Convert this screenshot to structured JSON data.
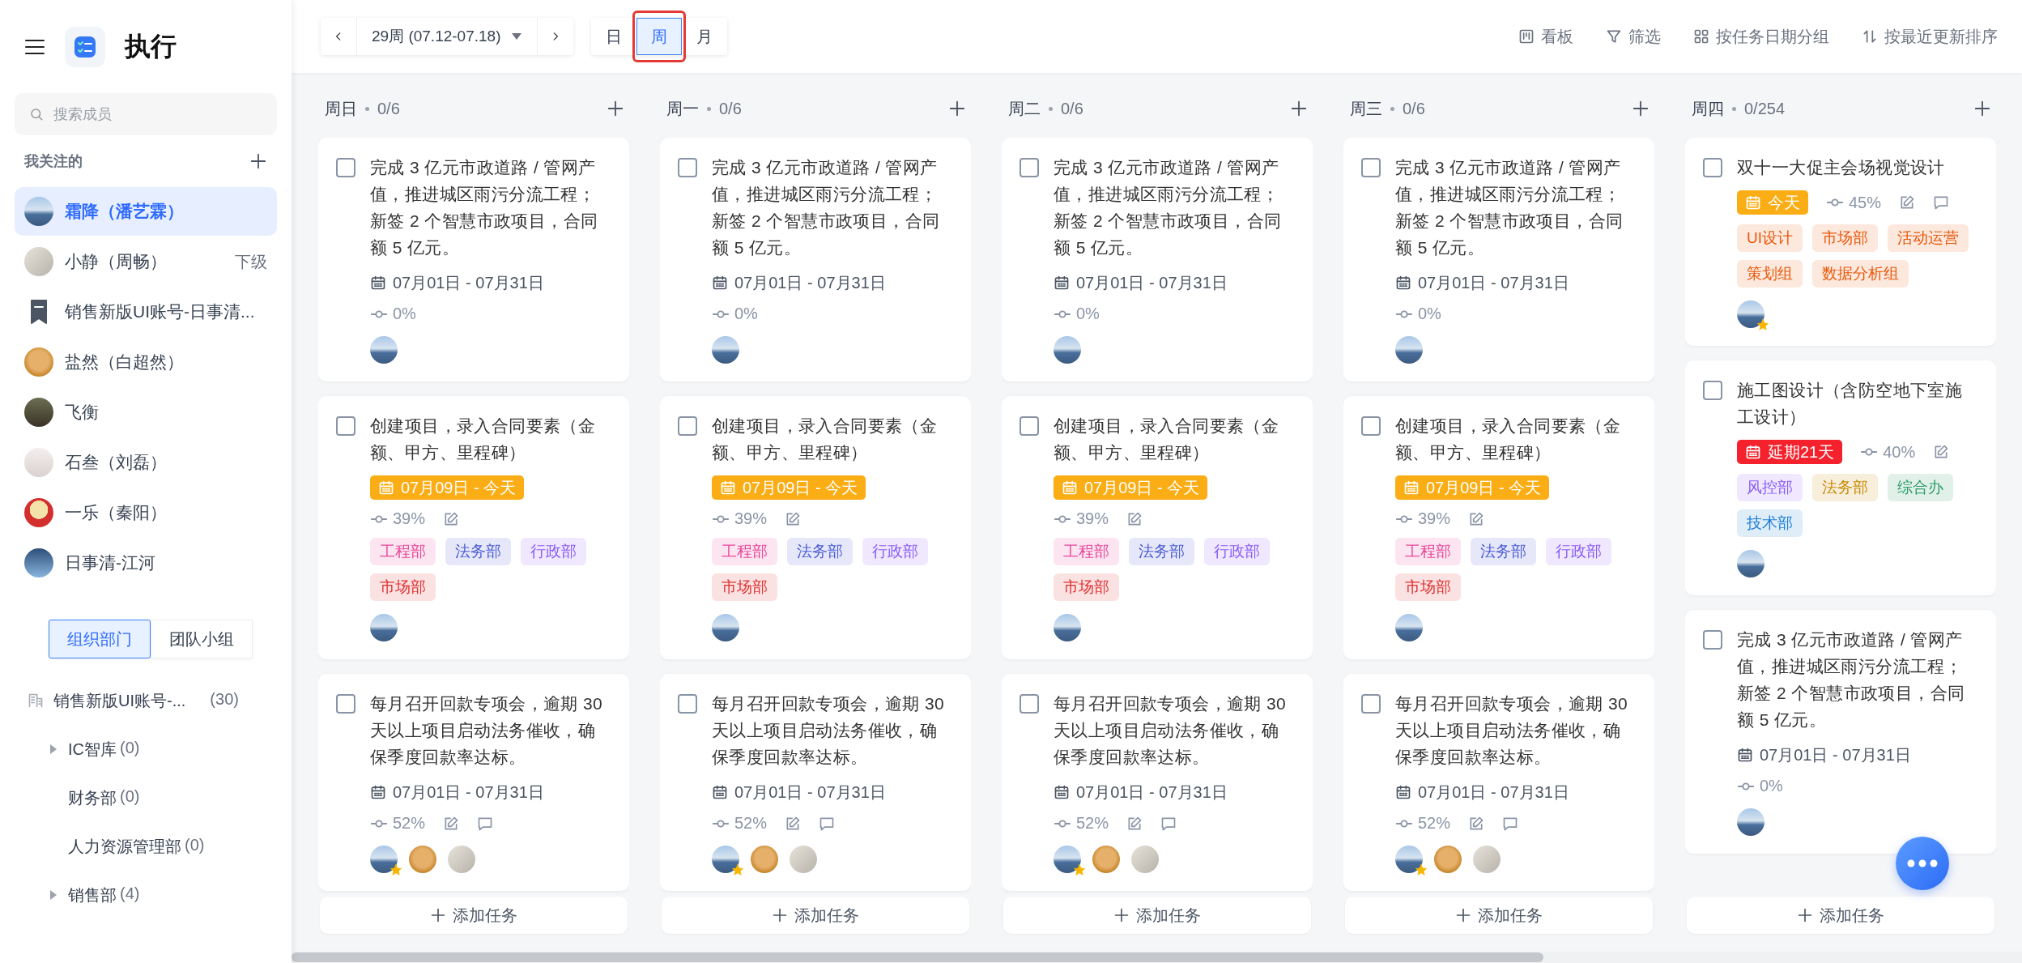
{
  "app": {
    "title": "执行"
  },
  "sidebar": {
    "search": {
      "placeholder": "搜索成员"
    },
    "followed_heading": "我关注的",
    "followed": [
      {
        "name": "霜降（潘艺霖）",
        "kind": "sea",
        "selected": true
      },
      {
        "name": "小静（周畅）",
        "kind": "sketch",
        "selected": false,
        "tag": "下级"
      },
      {
        "name": "销售新版UI账号-日事清...",
        "kind": "bookmark",
        "selected": false
      },
      {
        "name": "盐然（白超然）",
        "kind": "bear",
        "selected": false
      },
      {
        "name": "飞衡",
        "kind": "dusk",
        "selected": false
      },
      {
        "name": "石叁（刘磊）",
        "kind": "light",
        "selected": false
      },
      {
        "name": "一乐（秦阳）",
        "kind": "cartoon",
        "selected": false
      },
      {
        "name": "日事清-江河",
        "kind": "blue",
        "selected": false
      }
    ],
    "org_tabs": [
      {
        "label": "组织部门",
        "selected": true
      },
      {
        "label": "团队小组",
        "selected": false
      }
    ],
    "tree": [
      {
        "name": "销售新版UI账号-...",
        "count": "(30)",
        "kind": "company",
        "children": [
          {
            "name": "IC智库",
            "count": "(0)",
            "kind": "folder"
          },
          {
            "name": "财务部",
            "count": "(0)",
            "kind": "leaf"
          },
          {
            "name": "人力资源管理部",
            "count": "(0)",
            "kind": "leaf"
          },
          {
            "name": "销售部",
            "count": "(4)",
            "kind": "folder"
          }
        ]
      }
    ]
  },
  "toolbar": {
    "week": "29周 (07.12-07.18)",
    "view_tabs": [
      {
        "label": "日",
        "selected": false,
        "highlighted": false
      },
      {
        "label": "周",
        "selected": true,
        "highlighted": true
      },
      {
        "label": "月",
        "selected": false,
        "highlighted": false
      }
    ],
    "actions": [
      {
        "label": "看板",
        "kind": "board"
      },
      {
        "label": "筛选",
        "kind": "filter"
      },
      {
        "label": "按任务日期分组",
        "kind": "grid"
      },
      {
        "label": "按最近更新排序",
        "kind": "sort"
      }
    ]
  },
  "columns": [
    {
      "day": "周日",
      "count": "0/6",
      "add_label": "添加任务",
      "tasks": [
        {
          "title": "完成 3 亿元市政道路 / 管网产值，推进城区雨污分流工程；新签 2 个智慧市政项目，合同额 5 亿元。",
          "checked": false,
          "date": {
            "text": "07月01日 - 07月31日",
            "kind": "normal"
          },
          "progress": "0%",
          "progress_inline": false,
          "edit": false,
          "comment": false,
          "avatars": [
            {
              "kind": "sea",
              "star": false
            }
          ]
        },
        {
          "title": "创建项目，录入合同要素（金额、甲方、里程碑）",
          "checked": false,
          "date": {
            "text": "07月09日 - 今天",
            "kind": "today"
          },
          "progress": "39%",
          "progress_inline": false,
          "edit": true,
          "comment": false,
          "tags": [
            {
              "label": "工程部",
              "color": "#e8479a"
            },
            {
              "label": "法务部",
              "color": "#4c5bd4"
            },
            {
              "label": "行政部",
              "color": "#8b5cf6"
            },
            {
              "label": "市场部",
              "color": "#e03131"
            }
          ],
          "avatars": [
            {
              "kind": "sea",
              "star": false
            }
          ]
        },
        {
          "title": "每月召开回款专项会，逾期 30 天以上项目启动法务催收，确保季度回款率达标。",
          "checked": false,
          "date": {
            "text": "07月01日 - 07月31日",
            "kind": "normal"
          },
          "progress": "52%",
          "progress_inline": false,
          "edit": true,
          "comment": true,
          "avatars": [
            {
              "kind": "sea",
              "star": true
            },
            {
              "kind": "bear",
              "star": false
            },
            {
              "kind": "sketch",
              "star": false
            }
          ]
        }
      ]
    },
    {
      "day": "周一",
      "count": "0/6",
      "add_label": "添加任务",
      "tasks": [
        {
          "title": "完成 3 亿元市政道路 / 管网产值，推进城区雨污分流工程；新签 2 个智慧市政项目，合同额 5 亿元。",
          "checked": false,
          "date": {
            "text": "07月01日 - 07月31日",
            "kind": "normal"
          },
          "progress": "0%",
          "progress_inline": false,
          "edit": false,
          "comment": false,
          "avatars": [
            {
              "kind": "sea",
              "star": false
            }
          ]
        },
        {
          "title": "创建项目，录入合同要素（金额、甲方、里程碑）",
          "checked": false,
          "date": {
            "text": "07月09日 - 今天",
            "kind": "today"
          },
          "progress": "39%",
          "progress_inline": false,
          "edit": true,
          "comment": false,
          "tags": [
            {
              "label": "工程部",
              "color": "#e8479a"
            },
            {
              "label": "法务部",
              "color": "#4c5bd4"
            },
            {
              "label": "行政部",
              "color": "#8b5cf6"
            },
            {
              "label": "市场部",
              "color": "#e03131"
            }
          ],
          "avatars": [
            {
              "kind": "sea",
              "star": false
            }
          ]
        },
        {
          "title": "每月召开回款专项会，逾期 30 天以上项目启动法务催收，确保季度回款率达标。",
          "checked": false,
          "date": {
            "text": "07月01日 - 07月31日",
            "kind": "normal"
          },
          "progress": "52%",
          "progress_inline": false,
          "edit": true,
          "comment": true,
          "avatars": [
            {
              "kind": "sea",
              "star": true
            },
            {
              "kind": "bear",
              "star": false
            },
            {
              "kind": "sketch",
              "star": false
            }
          ]
        }
      ]
    },
    {
      "day": "周二",
      "count": "0/6",
      "add_label": "添加任务",
      "tasks": [
        {
          "title": "完成 3 亿元市政道路 / 管网产值，推进城区雨污分流工程；新签 2 个智慧市政项目，合同额 5 亿元。",
          "checked": false,
          "date": {
            "text": "07月01日 - 07月31日",
            "kind": "normal"
          },
          "progress": "0%",
          "progress_inline": false,
          "edit": false,
          "comment": false,
          "avatars": [
            {
              "kind": "sea",
              "star": false
            }
          ]
        },
        {
          "title": "创建项目，录入合同要素（金额、甲方、里程碑）",
          "checked": false,
          "date": {
            "text": "07月09日 - 今天",
            "kind": "today"
          },
          "progress": "39%",
          "progress_inline": false,
          "edit": true,
          "comment": false,
          "tags": [
            {
              "label": "工程部",
              "color": "#e8479a"
            },
            {
              "label": "法务部",
              "color": "#4c5bd4"
            },
            {
              "label": "行政部",
              "color": "#8b5cf6"
            },
            {
              "label": "市场部",
              "color": "#e03131"
            }
          ],
          "avatars": [
            {
              "kind": "sea",
              "star": false
            }
          ]
        },
        {
          "title": "每月召开回款专项会，逾期 30 天以上项目启动法务催收，确保季度回款率达标。",
          "checked": false,
          "date": {
            "text": "07月01日 - 07月31日",
            "kind": "normal"
          },
          "progress": "52%",
          "progress_inline": false,
          "edit": true,
          "comment": true,
          "avatars": [
            {
              "kind": "sea",
              "star": true
            },
            {
              "kind": "bear",
              "star": false
            },
            {
              "kind": "sketch",
              "star": false
            }
          ]
        }
      ]
    },
    {
      "day": "周三",
      "count": "0/6",
      "add_label": "添加任务",
      "tasks": [
        {
          "title": "完成 3 亿元市政道路 / 管网产值，推进城区雨污分流工程；新签 2 个智慧市政项目，合同额 5 亿元。",
          "checked": false,
          "date": {
            "text": "07月01日 - 07月31日",
            "kind": "normal"
          },
          "progress": "0%",
          "progress_inline": false,
          "edit": false,
          "comment": false,
          "avatars": [
            {
              "kind": "sea",
              "star": false
            }
          ]
        },
        {
          "title": "创建项目，录入合同要素（金额、甲方、里程碑）",
          "checked": false,
          "date": {
            "text": "07月09日 - 今天",
            "kind": "today"
          },
          "progress": "39%",
          "progress_inline": false,
          "edit": true,
          "comment": false,
          "tags": [
            {
              "label": "工程部",
              "color": "#e8479a"
            },
            {
              "label": "法务部",
              "color": "#4c5bd4"
            },
            {
              "label": "行政部",
              "color": "#8b5cf6"
            },
            {
              "label": "市场部",
              "color": "#e03131"
            }
          ],
          "avatars": [
            {
              "kind": "sea",
              "star": false
            }
          ]
        },
        {
          "title": "每月召开回款专项会，逾期 30 天以上项目启动法务催收，确保季度回款率达标。",
          "checked": false,
          "date": {
            "text": "07月01日 - 07月31日",
            "kind": "normal"
          },
          "progress": "52%",
          "progress_inline": false,
          "edit": true,
          "comment": true,
          "avatars": [
            {
              "kind": "sea",
              "star": true
            },
            {
              "kind": "bear",
              "star": false
            },
            {
              "kind": "sketch",
              "star": false
            }
          ]
        }
      ]
    },
    {
      "day": "周四",
      "count": "0/254",
      "add_label": "添加任务",
      "tasks": [
        {
          "title": "双十一大促主会场视觉设计",
          "checked": false,
          "date": {
            "text": "今天",
            "kind": "today"
          },
          "progress": "45%",
          "progress_inline": true,
          "edit": true,
          "comment": true,
          "tags": [
            {
              "label": "UI设计",
              "color": "#e8590c"
            },
            {
              "label": "市场部",
              "color": "#e8590c"
            },
            {
              "label": "活动运营",
              "color": "#e8590c"
            },
            {
              "label": "策划组",
              "color": "#e8590c"
            },
            {
              "label": "数据分析组",
              "color": "#e8590c"
            }
          ],
          "avatars": [
            {
              "kind": "sea",
              "star": true
            }
          ]
        },
        {
          "title": "施工图设计（含防空地下室施工设计）",
          "checked": false,
          "date": {
            "text": "延期21天",
            "kind": "overdue"
          },
          "progress": "40%",
          "progress_inline": true,
          "edit": true,
          "comment": false,
          "tags": [
            {
              "label": "风控部",
              "color": "#8b5cf6"
            },
            {
              "label": "法务部",
              "color": "#c98a06"
            },
            {
              "label": "综合办",
              "color": "#2b9a66"
            },
            {
              "label": "技术部",
              "color": "#1c7ed6"
            }
          ],
          "avatars": [
            {
              "kind": "sea",
              "star": false
            }
          ]
        },
        {
          "title": "完成 3 亿元市政道路 / 管网产值，推进城区雨污分流工程；新签 2 个智慧市政项目，合同额 5 亿元。",
          "checked": false,
          "date": {
            "text": "07月01日 - 07月31日",
            "kind": "normal"
          },
          "progress": "0%",
          "progress_inline": false,
          "edit": false,
          "comment": false,
          "avatars": [
            {
              "kind": "sea",
              "star": false
            }
          ]
        }
      ]
    }
  ]
}
